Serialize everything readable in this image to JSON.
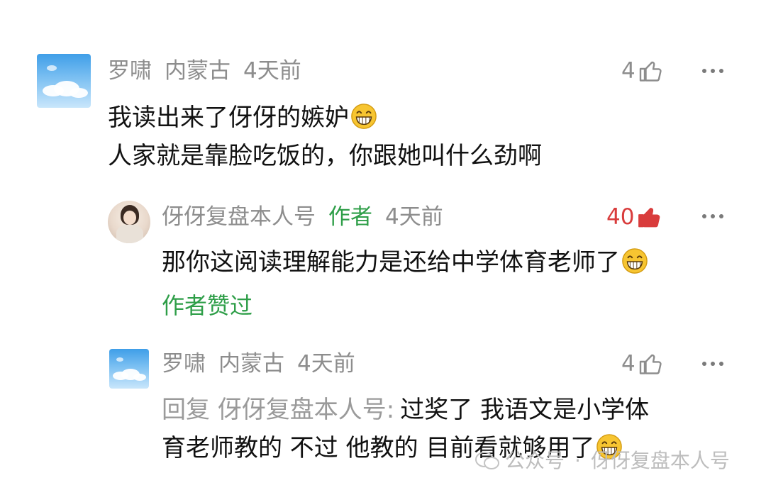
{
  "comments": [
    {
      "user": "罗啸",
      "location": "内蒙古",
      "time": "4天前",
      "likes": "4",
      "avatar": "sky-cloud-avatar",
      "lines": [
        "我读出来了伢伢的嫉妒",
        "人家就是靠脸吃饭的，你跟她叫什么劲啊"
      ]
    },
    {
      "user": "伢伢复盘本人号",
      "author_tag": "作者",
      "time": "4天前",
      "likes": "40",
      "liked": true,
      "avatar": "portrait-avatar",
      "lines": [
        "那你这阅读理解能力是还给中学体育老师了"
      ],
      "liked_by_author": "作者赞过"
    },
    {
      "user": "罗啸",
      "location": "内蒙古",
      "time": "4天前",
      "likes": "4",
      "avatar": "sky-cloud-avatar",
      "reply_prefix": "回复 伢伢复盘本人号:",
      "lines": [
        "过奖了 我语文是小学体",
        "育老师教的 不过 他教的 目前看就够用了"
      ]
    }
  ],
  "watermark": {
    "source": "公众号",
    "separator": "·",
    "name": "伢伢复盘本人号"
  },
  "colors": {
    "author_green": "#2e9e48",
    "liked_red": "#d93c3c",
    "meta_gray": "#8d8d8d"
  },
  "icons": {
    "like": "thumbs-up-icon",
    "more": "more-dots-icon",
    "emoji": "grin-emoji-icon"
  }
}
